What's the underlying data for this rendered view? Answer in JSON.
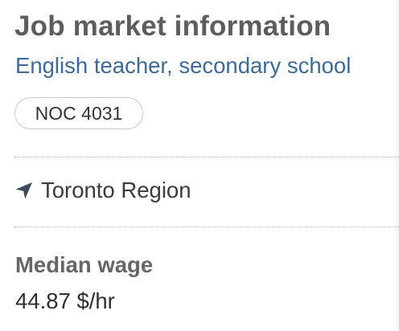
{
  "header": {
    "title": "Job market information",
    "occupation": "English teacher, secondary school",
    "noc_code": "NOC 4031"
  },
  "location": {
    "icon": "location-arrow-icon",
    "region": "Toronto Region"
  },
  "wage": {
    "label": "Median wage",
    "value": "44.87 $/hr"
  },
  "colors": {
    "title": "#5d5d5d",
    "occupation_link": "#3e6a9a",
    "text": "#3b3b3b",
    "badge_border": "#c9c9c9",
    "divider": "#b8b8b8"
  }
}
